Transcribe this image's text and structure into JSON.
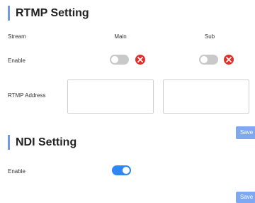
{
  "rtmp": {
    "title": "RTMP Setting",
    "stream_label": "Stream",
    "col_main": "Main",
    "col_sub": "Sub",
    "enable_label": "Enable",
    "main_enabled": false,
    "sub_enabled": false,
    "address_label": "RTMP Address",
    "main_address": "",
    "sub_address": "",
    "save_label": "Save"
  },
  "ndi": {
    "title": "NDI Setting",
    "enable_label": "Enable",
    "enabled": true,
    "save_label": "Save"
  },
  "colors": {
    "accent": "#7399e6",
    "toggle_on": "#2f86f5",
    "toggle_off": "#c9c9c9",
    "delete": "#e0302a",
    "save_button": "#7ea8ef"
  },
  "icons": {
    "clear": "close-circle-icon"
  }
}
